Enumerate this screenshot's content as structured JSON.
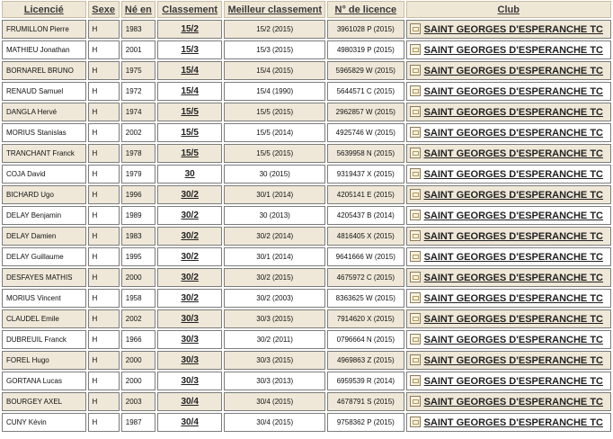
{
  "headers": {
    "licencie": "Licencié",
    "sexe": "Sexe",
    "ne_en": "Né en",
    "classement": "Classement",
    "meilleur": "Meilleur classement",
    "licence": "N° de licence",
    "club": "Club"
  },
  "rows": [
    {
      "name": "FRUMILLON Pierre",
      "sexe": "H",
      "year": "1983",
      "rank": "15/2",
      "best": "15/2 (2015)",
      "licence": "3961028 P  (2015)",
      "club": "SAINT GEORGES D'ESPERANCHE TC"
    },
    {
      "name": "MATHIEU Jonathan",
      "sexe": "H",
      "year": "2001",
      "rank": "15/3",
      "best": "15/3 (2015)",
      "licence": "4980319 P  (2015)",
      "club": "SAINT GEORGES D'ESPERANCHE TC"
    },
    {
      "name": "BORNAREL BRUNO",
      "sexe": "H",
      "year": "1975",
      "rank": "15/4",
      "best": "15/4 (2015)",
      "licence": "5965829 W  (2015)",
      "club": "SAINT GEORGES D'ESPERANCHE TC"
    },
    {
      "name": "RENAUD Samuel",
      "sexe": "H",
      "year": "1972",
      "rank": "15/4",
      "best": "15/4 (1990)",
      "licence": "5644571 C  (2015)",
      "club": "SAINT GEORGES D'ESPERANCHE TC"
    },
    {
      "name": "DANGLA Hervé",
      "sexe": "H",
      "year": "1974",
      "rank": "15/5",
      "best": "15/5 (2015)",
      "licence": "2962857 W  (2015)",
      "club": "SAINT GEORGES D'ESPERANCHE TC"
    },
    {
      "name": "MORIUS Stanislas",
      "sexe": "H",
      "year": "2002",
      "rank": "15/5",
      "best": "15/5 (2014)",
      "licence": "4925746 W  (2015)",
      "club": "SAINT GEORGES D'ESPERANCHE TC"
    },
    {
      "name": "TRANCHANT Franck",
      "sexe": "H",
      "year": "1978",
      "rank": "15/5",
      "best": "15/5 (2015)",
      "licence": "5639958 N  (2015)",
      "club": "SAINT GEORGES D'ESPERANCHE TC"
    },
    {
      "name": "COJA David",
      "sexe": "H",
      "year": "1979",
      "rank": "30",
      "best": "30 (2015)",
      "licence": "9319437 X  (2015)",
      "club": "SAINT GEORGES D'ESPERANCHE TC"
    },
    {
      "name": "BICHARD Ugo",
      "sexe": "H",
      "year": "1996",
      "rank": "30/2",
      "best": "30/1 (2014)",
      "licence": "4205141 E  (2015)",
      "club": "SAINT GEORGES D'ESPERANCHE TC"
    },
    {
      "name": "DELAY Benjamin",
      "sexe": "H",
      "year": "1989",
      "rank": "30/2",
      "best": "30 (2013)",
      "licence": "4205437 B  (2014)",
      "club": "SAINT GEORGES D'ESPERANCHE TC"
    },
    {
      "name": "DELAY Damien",
      "sexe": "H",
      "year": "1983",
      "rank": "30/2",
      "best": "30/2 (2014)",
      "licence": "4816405 X  (2015)",
      "club": "SAINT GEORGES D'ESPERANCHE TC"
    },
    {
      "name": "DELAY Guillaume",
      "sexe": "H",
      "year": "1995",
      "rank": "30/2",
      "best": "30/1 (2014)",
      "licence": "9641666 W  (2015)",
      "club": "SAINT GEORGES D'ESPERANCHE TC"
    },
    {
      "name": "DESFAYES MATHIS",
      "sexe": "H",
      "year": "2000",
      "rank": "30/2",
      "best": "30/2 (2015)",
      "licence": "4675972 C  (2015)",
      "club": "SAINT GEORGES D'ESPERANCHE TC"
    },
    {
      "name": "MORIUS Vincent",
      "sexe": "H",
      "year": "1958",
      "rank": "30/2",
      "best": "30/2 (2003)",
      "licence": "8363625 W  (2015)",
      "club": "SAINT GEORGES D'ESPERANCHE TC"
    },
    {
      "name": "CLAUDEL Emile",
      "sexe": "H",
      "year": "2002",
      "rank": "30/3",
      "best": "30/3 (2015)",
      "licence": "7914620 X  (2015)",
      "club": "SAINT GEORGES D'ESPERANCHE TC"
    },
    {
      "name": "DUBREUIL Franck",
      "sexe": "H",
      "year": "1966",
      "rank": "30/3",
      "best": "30/2 (2011)",
      "licence": "0796664 N  (2015)",
      "club": "SAINT GEORGES D'ESPERANCHE TC"
    },
    {
      "name": "FOREL Hugo",
      "sexe": "H",
      "year": "2000",
      "rank": "30/3",
      "best": "30/3 (2015)",
      "licence": "4969863 Z  (2015)",
      "club": "SAINT GEORGES D'ESPERANCHE TC"
    },
    {
      "name": "GORTANA Lucas",
      "sexe": "H",
      "year": "2000",
      "rank": "30/3",
      "best": "30/3 (2013)",
      "licence": "6959539 R  (2014)",
      "club": "SAINT GEORGES D'ESPERANCHE TC"
    },
    {
      "name": "BOURGEY AXEL",
      "sexe": "H",
      "year": "2003",
      "rank": "30/4",
      "best": "30/4 (2015)",
      "licence": "4678791 S  (2015)",
      "club": "SAINT GEORGES D'ESPERANCHE TC"
    },
    {
      "name": "CUNY Kévin",
      "sexe": "H",
      "year": "1987",
      "rank": "30/4",
      "best": "30/4 (2015)",
      "licence": "9758362 P  (2015)",
      "club": "SAINT GEORGES D'ESPERANCHE TC"
    }
  ]
}
